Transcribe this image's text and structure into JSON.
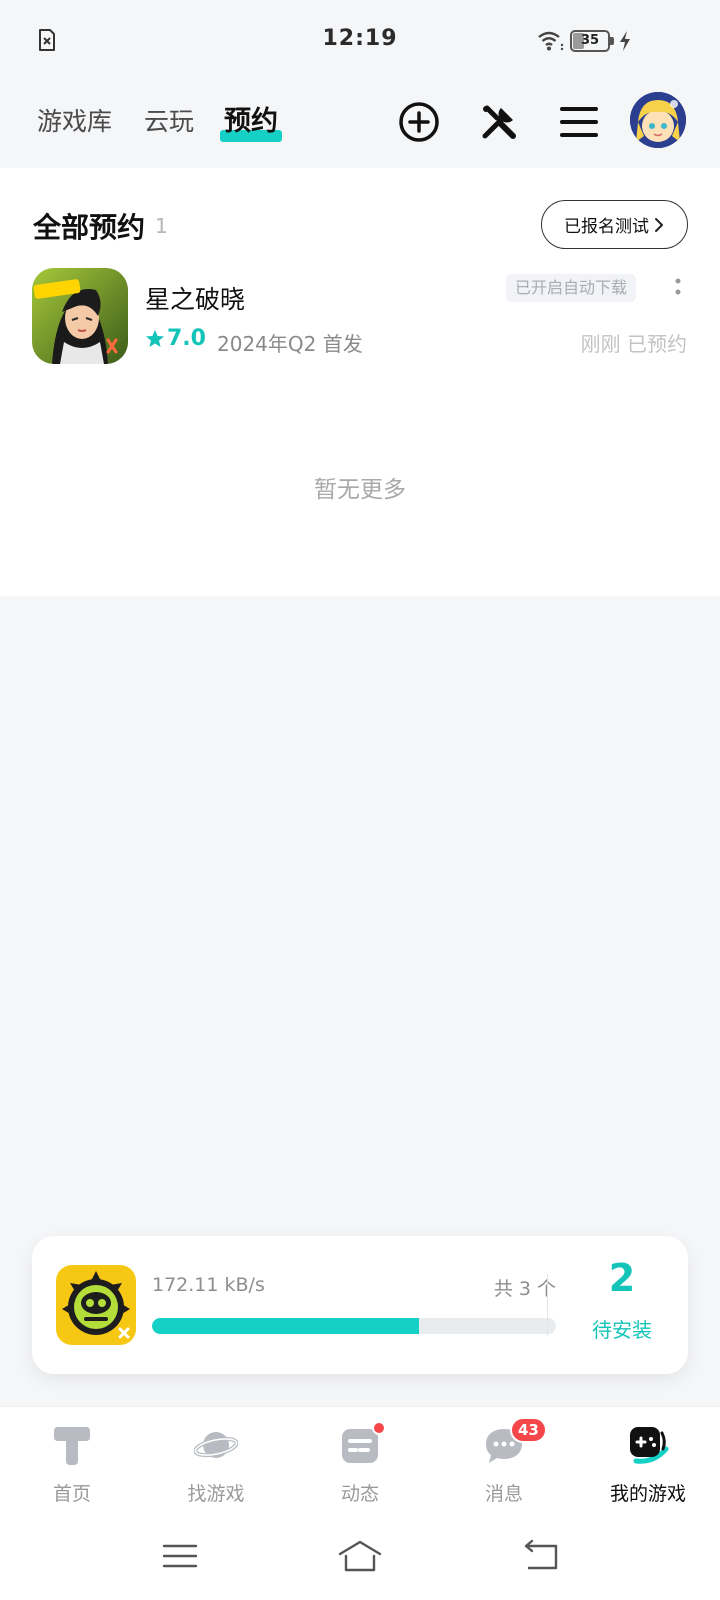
{
  "status_bar": {
    "time": "12:19",
    "battery_level": "35",
    "battery_fraction": 0.35,
    "icons": [
      "sim-missing-icon",
      "wifi-icon",
      "battery-icon",
      "charging-icon"
    ]
  },
  "top_nav": {
    "tabs": [
      {
        "label": "游戏库",
        "active": false
      },
      {
        "label": "云玩",
        "active": false
      },
      {
        "label": "预约",
        "active": true
      }
    ],
    "actions": [
      "add-circle-icon",
      "tools-icon",
      "menu-icon"
    ],
    "accent_color": "#14d0c5"
  },
  "reservations": {
    "title": "全部预约",
    "count": "1",
    "signup_test_label": "已报名测试",
    "items": [
      {
        "name": "星之破晓",
        "rating": "7.0",
        "release": "2024年Q2 首发",
        "auto_download_tag": "已开启自动下载",
        "reserved_status": "刚刚 已预约"
      }
    ],
    "no_more_text": "暂无更多"
  },
  "download_card": {
    "speed": "172.11 kB/s",
    "total": "共 3 个",
    "progress_fraction": 0.66,
    "pending_count": "2",
    "pending_label": "待安装"
  },
  "bottom_nav": {
    "items": [
      {
        "label": "首页",
        "icon": "home-t-icon"
      },
      {
        "label": "找游戏",
        "icon": "planet-icon"
      },
      {
        "label": "动态",
        "icon": "feed-icon",
        "has_dot": true
      },
      {
        "label": "消息",
        "icon": "chat-icon",
        "badge": "43"
      },
      {
        "label": "我的游戏",
        "icon": "my-games-icon",
        "active": true
      }
    ]
  },
  "system_nav": [
    "recent-apps-icon",
    "home-icon",
    "back-icon"
  ]
}
